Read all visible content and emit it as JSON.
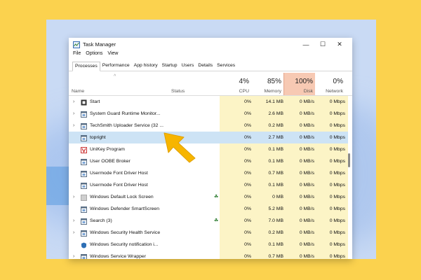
{
  "colors": {
    "background": "#fbd24e",
    "selection": "#cde3f5",
    "resource_highlight": "#fcf4c6",
    "disk_header": "#f7c9b3",
    "arrow": "#f7b500"
  },
  "window": {
    "title": "Task Manager",
    "minimize": "—",
    "maximize": "☐",
    "close": "✕"
  },
  "menu": [
    "File",
    "Options",
    "View"
  ],
  "tabs": [
    "Processes",
    "Performance",
    "App history",
    "Startup",
    "Users",
    "Details",
    "Services"
  ],
  "columns": {
    "name": "Name",
    "status": "Status",
    "cpu": {
      "percent": "4%",
      "label": "CPU"
    },
    "memory": {
      "percent": "85%",
      "label": "Memory"
    },
    "disk": {
      "percent": "100%",
      "label": "Disk"
    },
    "network": {
      "percent": "0%",
      "label": "Network"
    }
  },
  "processes": [
    {
      "name": "Start",
      "expandable": true,
      "icon": "start-icon",
      "status_icon": false,
      "cpu": "0%",
      "memory": "14.1 MB",
      "disk": "0 MB/s",
      "network": "0 Mbps",
      "selected": false
    },
    {
      "name": "System Guard Runtime Monitor...",
      "expandable": true,
      "icon": "app-window-icon",
      "status_icon": false,
      "cpu": "0%",
      "memory": "2.6 MB",
      "disk": "0 MB/s",
      "network": "0 Mbps",
      "selected": false
    },
    {
      "name": "TechSmith Uploader Service (32 ...",
      "expandable": true,
      "icon": "app-window-icon",
      "status_icon": false,
      "cpu": "0%",
      "memory": "0.2 MB",
      "disk": "0 MB/s",
      "network": "0 Mbps",
      "selected": false
    },
    {
      "name": "topright",
      "expandable": false,
      "icon": "app-window-icon",
      "status_icon": false,
      "cpu": "0%",
      "memory": "2.7 MB",
      "disk": "0 MB/s",
      "network": "0 Mbps",
      "selected": true
    },
    {
      "name": "UniKey Program",
      "expandable": false,
      "icon": "unikey-icon",
      "status_icon": false,
      "cpu": "0%",
      "memory": "0.1 MB",
      "disk": "0 MB/s",
      "network": "0 Mbps",
      "selected": false
    },
    {
      "name": "User OOBE Broker",
      "expandable": false,
      "icon": "app-window-icon",
      "status_icon": false,
      "cpu": "0%",
      "memory": "0.1 MB",
      "disk": "0 MB/s",
      "network": "0 Mbps",
      "selected": false
    },
    {
      "name": "Usermode Font Driver Host",
      "expandable": false,
      "icon": "app-window-icon",
      "status_icon": false,
      "cpu": "0%",
      "memory": "0.7 MB",
      "disk": "0 MB/s",
      "network": "0 Mbps",
      "selected": false
    },
    {
      "name": "Usermode Font Driver Host",
      "expandable": false,
      "icon": "app-window-icon",
      "status_icon": false,
      "cpu": "0%",
      "memory": "0.1 MB",
      "disk": "0 MB/s",
      "network": "0 Mbps",
      "selected": false
    },
    {
      "name": "Windows Default Lock Screen",
      "expandable": true,
      "icon": "lock-screen-icon",
      "status_icon": true,
      "cpu": "0%",
      "memory": "0 MB",
      "disk": "0 MB/s",
      "network": "0 Mbps",
      "selected": false
    },
    {
      "name": "Windows Defender SmartScreen",
      "expandable": false,
      "icon": "app-window-icon",
      "status_icon": false,
      "cpu": "0%",
      "memory": "5.2 MB",
      "disk": "0 MB/s",
      "network": "0 Mbps",
      "selected": false
    },
    {
      "name": "Search (3)",
      "expandable": true,
      "icon": "app-window-icon",
      "status_icon": true,
      "cpu": "0%",
      "memory": "7.0 MB",
      "disk": "0 MB/s",
      "network": "0 Mbps",
      "selected": false
    },
    {
      "name": "Windows Security Health Service",
      "expandable": true,
      "icon": "app-window-icon",
      "status_icon": false,
      "cpu": "0%",
      "memory": "0.2 MB",
      "disk": "0 MB/s",
      "network": "0 Mbps",
      "selected": false
    },
    {
      "name": "Windows Security notification i...",
      "expandable": false,
      "icon": "shield-icon",
      "status_icon": false,
      "cpu": "0%",
      "memory": "0.1 MB",
      "disk": "0 MB/s",
      "network": "0 Mbps",
      "selected": false
    },
    {
      "name": "Windows Service Wrapper",
      "expandable": true,
      "icon": "app-window-icon",
      "status_icon": false,
      "cpu": "0%",
      "memory": "0.7 MB",
      "disk": "0 MB/s",
      "network": "0 Mbps",
      "selected": false
    }
  ]
}
